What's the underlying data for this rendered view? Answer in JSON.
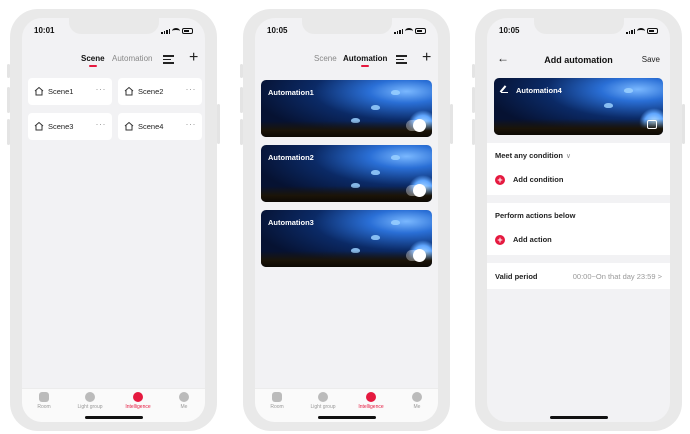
{
  "colors": {
    "accent": "#e5193f",
    "background": "#f2f2f4"
  },
  "status": {
    "time1": "10:01",
    "time2": "10:05",
    "time3": "10:05"
  },
  "tabs": {
    "scene": "Scene",
    "automation": "Automation"
  },
  "scenes": [
    {
      "label": "Scene1",
      "icon": "home-icon"
    },
    {
      "label": "Scene2",
      "icon": "home-icon"
    },
    {
      "label": "Scene3",
      "icon": "home-icon"
    },
    {
      "label": "Scene4",
      "icon": "home-icon"
    }
  ],
  "more_label": "···",
  "automations": [
    {
      "title": "Automation1",
      "enabled": true
    },
    {
      "title": "Automation2",
      "enabled": true
    },
    {
      "title": "Automation3",
      "enabled": true
    }
  ],
  "bottom_nav": [
    {
      "label": "Room",
      "icon": "room-icon"
    },
    {
      "label": "Light group",
      "icon": "light-group-icon"
    },
    {
      "label": "Intelligence",
      "icon": "intelligence-icon",
      "active": true
    },
    {
      "label": "Me",
      "icon": "me-icon"
    }
  ],
  "add_automation": {
    "back": "←",
    "title": "Add automation",
    "save": "Save",
    "name": "Automation4",
    "condition_header": "Meet any condition",
    "condition_chevron": "∨",
    "add_condition": "Add condition",
    "actions_header": "Perform actions below",
    "add_action": "Add action",
    "valid_label": "Valid period",
    "valid_value": "00:00~On that day 23:59",
    "valid_chevron": ">",
    "plus": "+"
  }
}
